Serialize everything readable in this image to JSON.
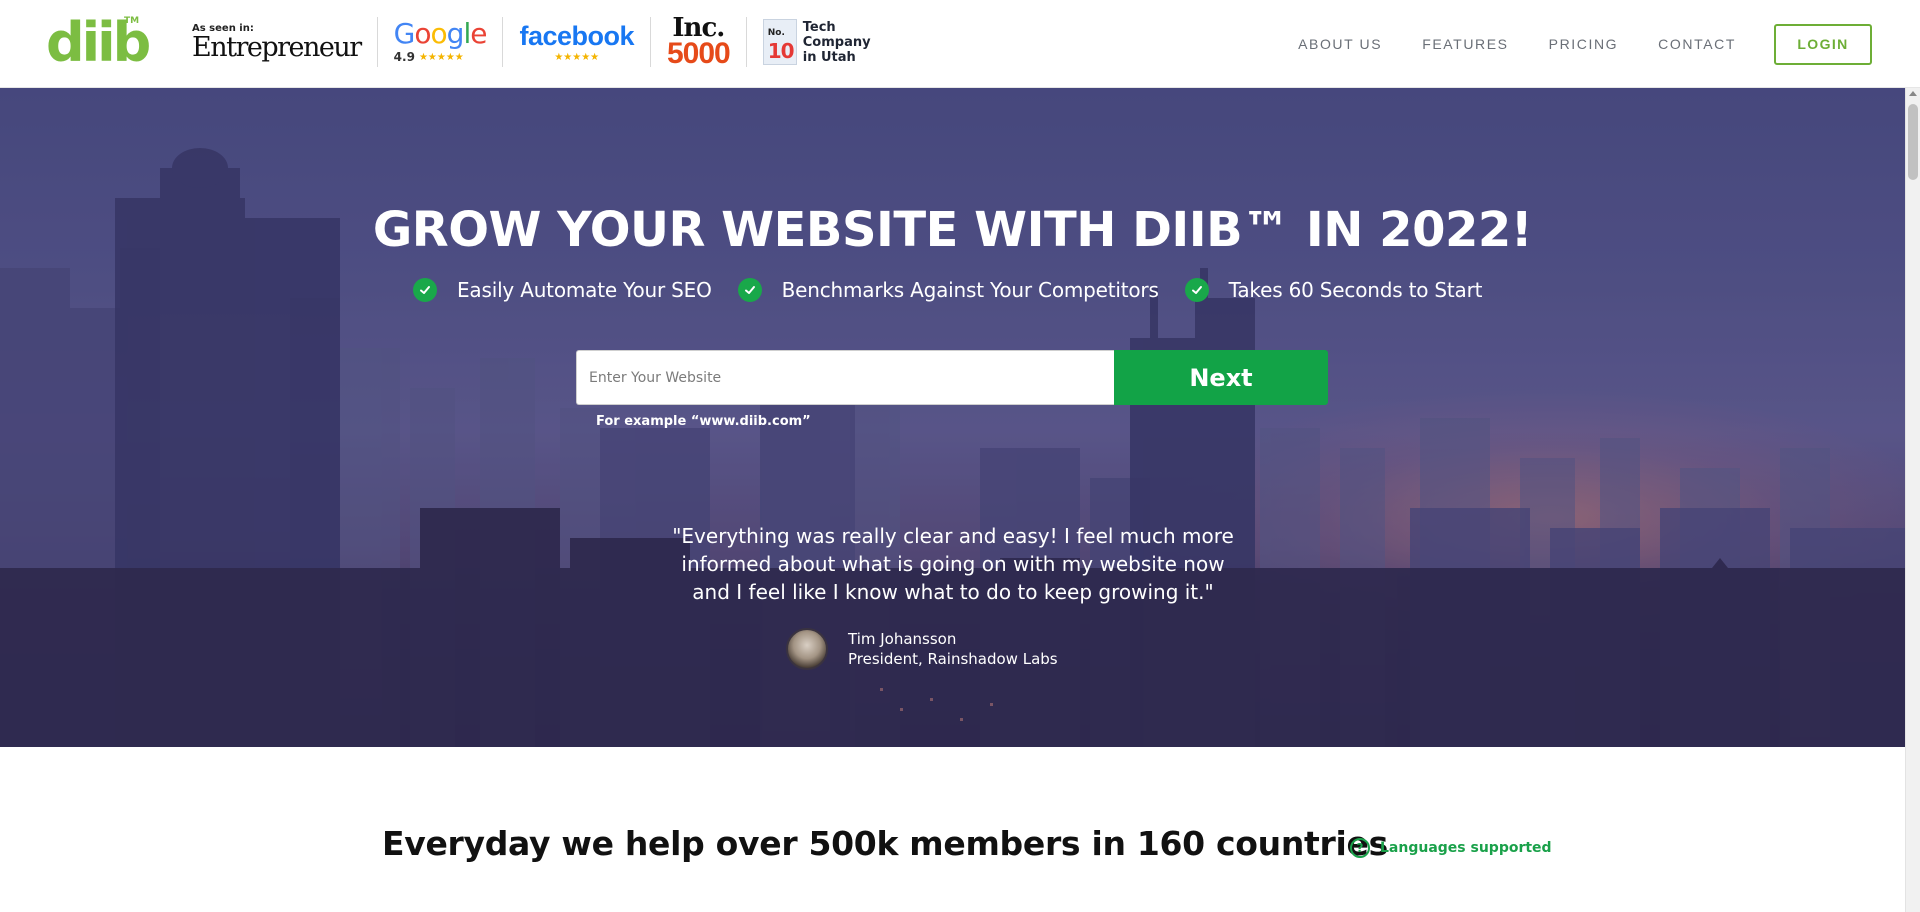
{
  "header": {
    "logo": "diib",
    "logo_tm": "TM",
    "press": {
      "as_seen_in": "As seen in:",
      "entrepreneur": "Entrepreneur",
      "google": "Google",
      "google_rating": "4.9",
      "google_stars": "★★★★★",
      "facebook": "facebook",
      "facebook_stars": "★★★★★",
      "inc": "Inc.",
      "inc_5000": "5000",
      "tech_no": "No.",
      "tech_10": "10",
      "tech_text_1": "Tech",
      "tech_text_2": "Company",
      "tech_text_3": "in Utah"
    },
    "nav": {
      "about": "ABOUT US",
      "features": "FEATURES",
      "pricing": "PRICING",
      "contact": "CONTACT",
      "login": "LOGIN"
    }
  },
  "hero": {
    "title": "GROW YOUR WEBSITE WITH DIIB™ IN 2022!",
    "benefits": [
      "Easily Automate Your SEO",
      "Benchmarks Against Your Competitors",
      "Takes 60 Seconds to Start"
    ],
    "search_placeholder": "Enter Your Website",
    "next_label": "Next",
    "example": "For example “www.diib.com”",
    "quote": "\"Everything was really clear and easy! I feel much more informed about what is going on with my website now and I feel like I know what to do to keep growing it.\"",
    "author_name": "Tim Johansson",
    "author_title": "President, Rainshadow Labs"
  },
  "members": {
    "headline": "Everyday we help over 500k members in 160 countries",
    "languages": "Languages supported"
  },
  "colors": {
    "brand_green": "#7cbd42",
    "cta_green": "#12a347",
    "hero_purple": "#56578c"
  }
}
